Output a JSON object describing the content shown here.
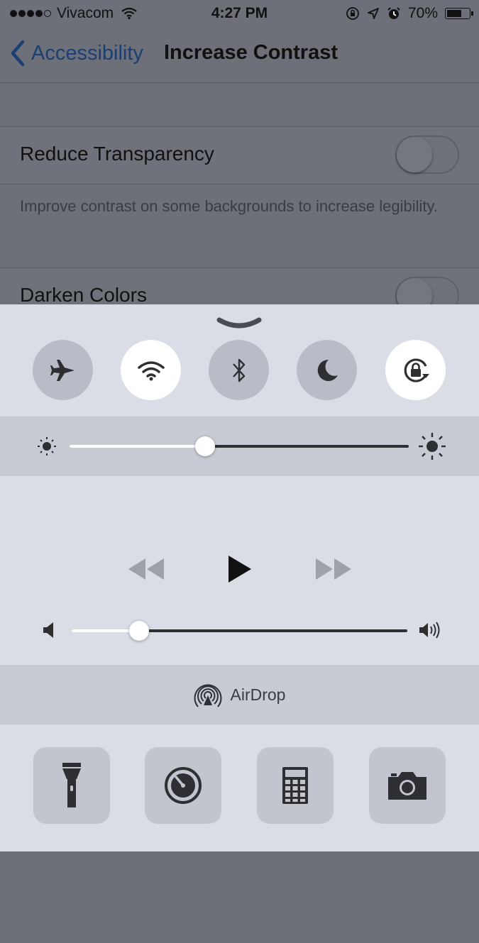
{
  "status_bar": {
    "carrier": "Vivacom",
    "time": "4:27 PM",
    "battery": "70%",
    "battery_level": 0.7
  },
  "nav": {
    "back_label": "Accessibility",
    "title": "Increase Contrast"
  },
  "settings": {
    "reduce_transparency": {
      "label": "Reduce Transparency",
      "enabled": false
    },
    "footnote": "Improve contrast on some backgrounds to increase legibility.",
    "darken_colors": {
      "label": "Darken Colors",
      "enabled": false
    }
  },
  "control_center": {
    "toggles": [
      {
        "name": "airplane-mode",
        "on": false
      },
      {
        "name": "wifi",
        "on": true
      },
      {
        "name": "bluetooth",
        "on": false
      },
      {
        "name": "do-not-disturb",
        "on": false
      },
      {
        "name": "rotation-lock",
        "on": true
      }
    ],
    "brightness_level": 0.4,
    "volume_level": 0.2,
    "airdrop_label": "AirDrop",
    "tools": [
      "flashlight-icon",
      "timer-icon",
      "calculator-icon",
      "camera-icon"
    ]
  },
  "colors": {
    "accent": "#1b3e73",
    "cc_background": "#dadde6",
    "dim_background": "#6d7079"
  }
}
